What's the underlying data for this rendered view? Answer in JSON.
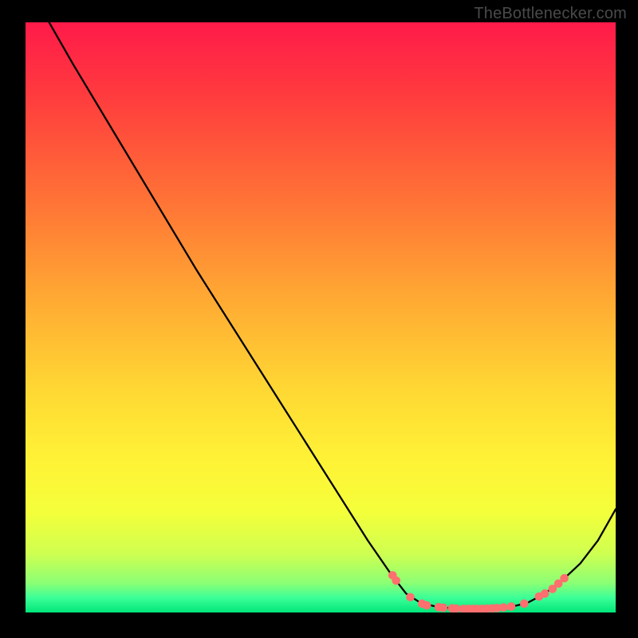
{
  "watermark": "TheBottlenecker.com",
  "chart_data": {
    "type": "line",
    "title": "",
    "xlabel": "",
    "ylabel": "",
    "xlim": [
      0,
      100
    ],
    "ylim": [
      0,
      100
    ],
    "background_gradient": {
      "stops": [
        {
          "offset": 0.0,
          "color": "#ff1a4a"
        },
        {
          "offset": 0.12,
          "color": "#ff3a3e"
        },
        {
          "offset": 0.3,
          "color": "#ff7236"
        },
        {
          "offset": 0.46,
          "color": "#ffa733"
        },
        {
          "offset": 0.62,
          "color": "#ffd733"
        },
        {
          "offset": 0.74,
          "color": "#fff236"
        },
        {
          "offset": 0.83,
          "color": "#f4ff3a"
        },
        {
          "offset": 0.9,
          "color": "#cfff50"
        },
        {
          "offset": 0.95,
          "color": "#8cff74"
        },
        {
          "offset": 0.975,
          "color": "#3cff98"
        },
        {
          "offset": 1.0,
          "color": "#00e67a"
        }
      ]
    },
    "series": [
      {
        "name": "bottleneck-curve",
        "stroke": "#000000",
        "points": [
          {
            "x": 4,
            "y": 100
          },
          {
            "x": 8,
            "y": 93
          },
          {
            "x": 29,
            "y": 58
          },
          {
            "x": 58,
            "y": 12.2
          },
          {
            "x": 62,
            "y": 6.4
          },
          {
            "x": 64.5,
            "y": 3.2
          },
          {
            "x": 67,
            "y": 1.6
          },
          {
            "x": 70,
            "y": 0.9
          },
          {
            "x": 74,
            "y": 0.6
          },
          {
            "x": 78,
            "y": 0.6
          },
          {
            "x": 82,
            "y": 0.9
          },
          {
            "x": 85,
            "y": 1.6
          },
          {
            "x": 88,
            "y": 3.2
          },
          {
            "x": 91,
            "y": 5.5
          },
          {
            "x": 94,
            "y": 8.3
          },
          {
            "x": 97,
            "y": 12.2
          },
          {
            "x": 100,
            "y": 17.5
          }
        ]
      }
    ],
    "markers": {
      "fill": "#ff6f6f",
      "stroke": "#c43d3d",
      "points": [
        {
          "x": 62.2,
          "y": 6.3
        },
        {
          "x": 62.8,
          "y": 5.4
        },
        {
          "x": 65.2,
          "y": 2.6
        },
        {
          "x": 67.2,
          "y": 1.5
        },
        {
          "x": 68.0,
          "y": 1.2
        },
        {
          "x": 70.0,
          "y": 0.9
        },
        {
          "x": 70.8,
          "y": 0.8
        },
        {
          "x": 72.3,
          "y": 0.7
        },
        {
          "x": 73.0,
          "y": 0.65
        },
        {
          "x": 74.2,
          "y": 0.6
        },
        {
          "x": 75.0,
          "y": 0.6
        },
        {
          "x": 75.8,
          "y": 0.6
        },
        {
          "x": 76.5,
          "y": 0.6
        },
        {
          "x": 77.4,
          "y": 0.62
        },
        {
          "x": 78.2,
          "y": 0.65
        },
        {
          "x": 79.1,
          "y": 0.7
        },
        {
          "x": 79.9,
          "y": 0.75
        },
        {
          "x": 81.0,
          "y": 0.85
        },
        {
          "x": 82.3,
          "y": 1.0
        },
        {
          "x": 84.5,
          "y": 1.5
        },
        {
          "x": 87.0,
          "y": 2.7
        },
        {
          "x": 88.0,
          "y": 3.2
        },
        {
          "x": 89.3,
          "y": 4.0
        },
        {
          "x": 90.3,
          "y": 4.9
        },
        {
          "x": 91.3,
          "y": 5.8
        }
      ]
    }
  }
}
